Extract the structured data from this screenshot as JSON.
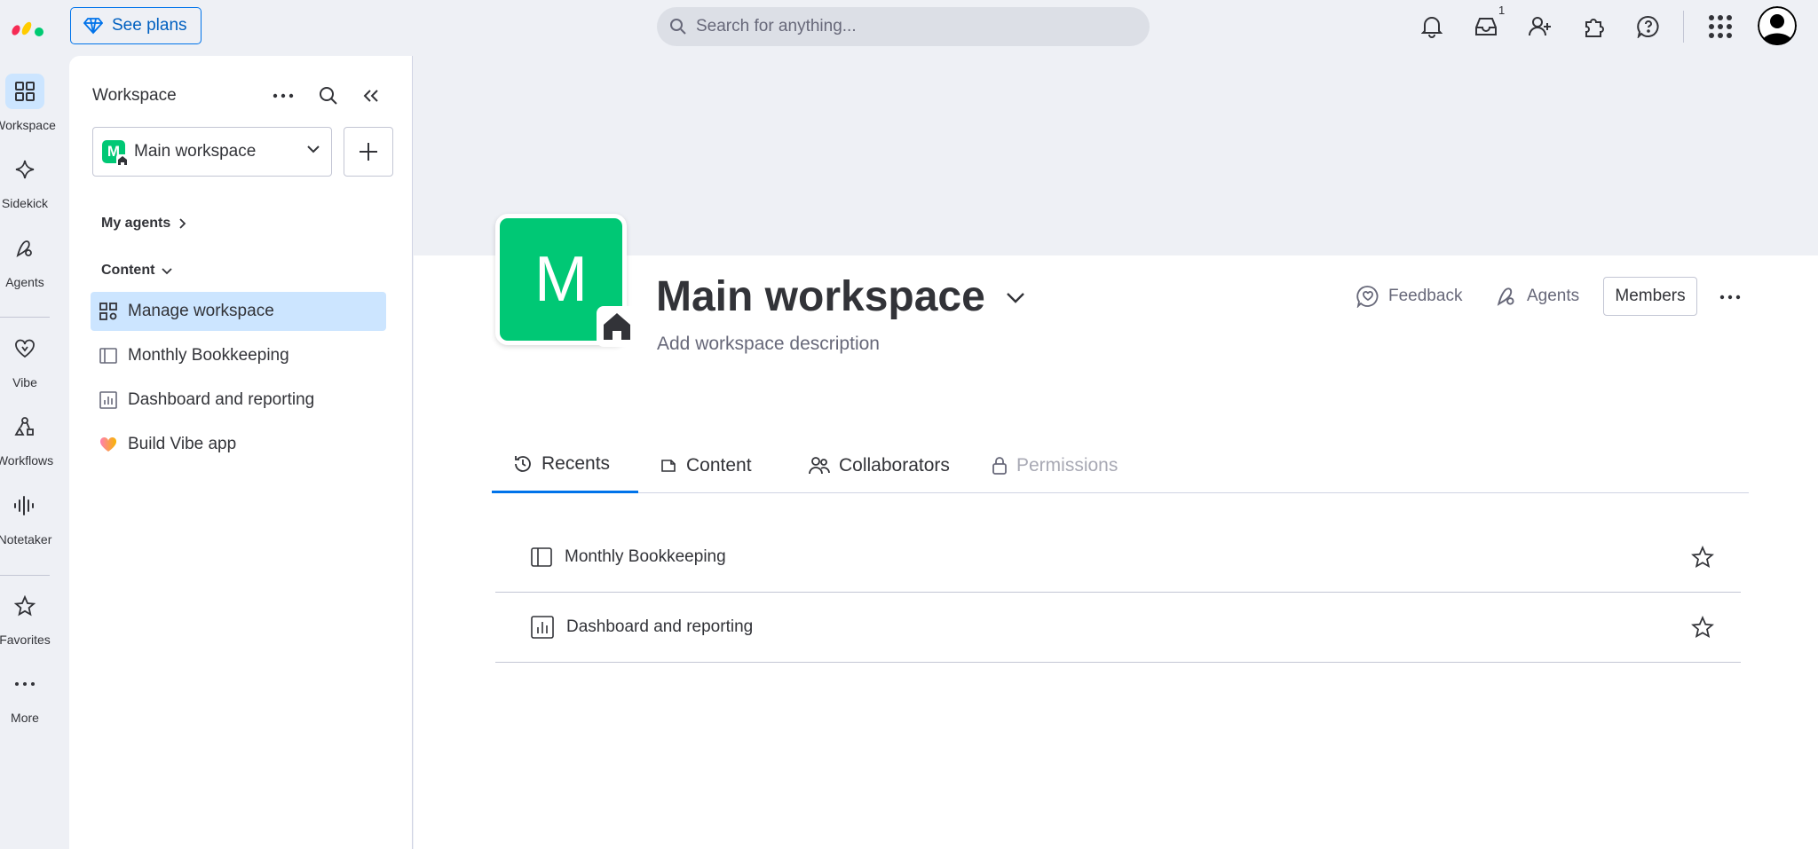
{
  "topbar": {
    "see_plans": "See plans",
    "search_placeholder": "Search for anything...",
    "inbox_count": "1"
  },
  "rail": {
    "items": [
      {
        "label": "Workspace",
        "icon": "grid-icon"
      },
      {
        "label": "Sidekick",
        "icon": "sparkle-icon"
      },
      {
        "label": "Agents",
        "icon": "agent-icon"
      },
      {
        "label": "Vibe",
        "icon": "heart-icon"
      },
      {
        "label": "Workflows",
        "icon": "workflow-icon"
      },
      {
        "label": "Notetaker",
        "icon": "waveform-icon"
      },
      {
        "label": "Favorites",
        "icon": "star-icon"
      },
      {
        "label": "More",
        "icon": "dots-icon"
      }
    ]
  },
  "sidebar": {
    "title": "Workspace",
    "workspace_name": "Main workspace",
    "workspace_initial": "M",
    "my_agents": "My agents",
    "content": "Content",
    "items": [
      {
        "label": "Manage workspace",
        "icon": "manage-icon"
      },
      {
        "label": "Monthly Bookkeeping",
        "icon": "board-icon"
      },
      {
        "label": "Dashboard and reporting",
        "icon": "dashboard-icon"
      },
      {
        "label": "Build Vibe app",
        "icon": "heart-icon"
      }
    ]
  },
  "main": {
    "initial": "M",
    "title": "Main workspace",
    "description": "Add workspace description",
    "feedback": "Feedback",
    "agents": "Agents",
    "members": "Members",
    "tabs": [
      "Recents",
      "Content",
      "Collaborators",
      "Permissions"
    ],
    "recents": [
      {
        "label": "Monthly Bookkeeping",
        "icon": "board-icon"
      },
      {
        "label": "Dashboard and reporting",
        "icon": "dashboard-icon"
      }
    ]
  },
  "colors": {
    "accent": "#0073ea",
    "brand_green": "#00c875",
    "selected_bg": "#cce5ff"
  }
}
